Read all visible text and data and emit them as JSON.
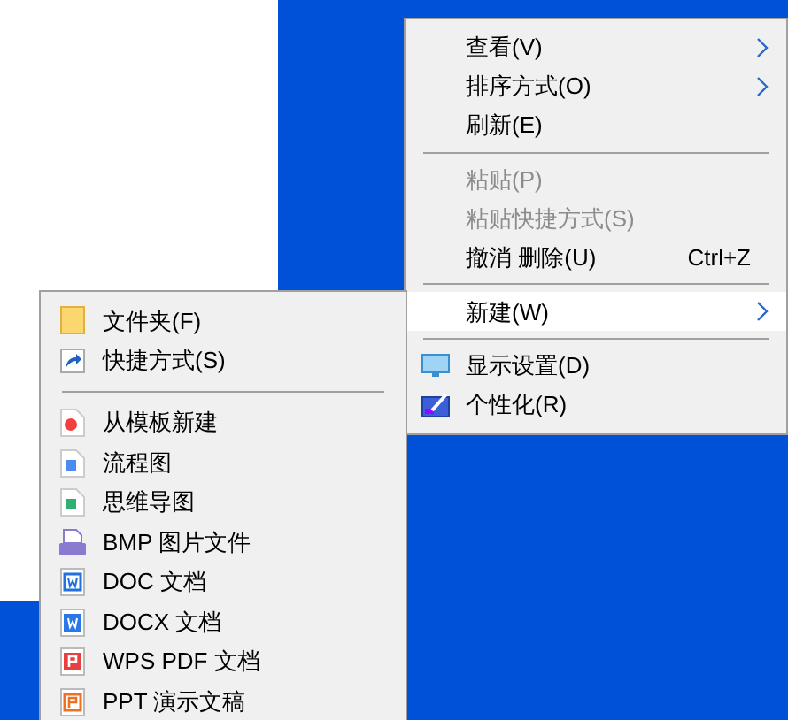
{
  "context_menu": {
    "items": [
      {
        "kind": "submenu",
        "label": "查看(V)",
        "disabled": false,
        "selected": false
      },
      {
        "kind": "submenu",
        "label": "排序方式(O)",
        "disabled": false,
        "selected": false
      },
      {
        "kind": "command",
        "label": "刷新(E)",
        "disabled": false,
        "selected": false
      },
      {
        "kind": "separator"
      },
      {
        "kind": "command",
        "label": "粘贴(P)",
        "disabled": true,
        "selected": false
      },
      {
        "kind": "command",
        "label": "粘贴快捷方式(S)",
        "disabled": true,
        "selected": false
      },
      {
        "kind": "command",
        "label": "撤消 删除(U)",
        "shortcut": "Ctrl+Z",
        "disabled": false,
        "selected": false
      },
      {
        "kind": "separator"
      },
      {
        "kind": "submenu",
        "label": "新建(W)",
        "disabled": false,
        "selected": true
      },
      {
        "kind": "separator"
      },
      {
        "kind": "display",
        "label": "显示设置(D)",
        "disabled": false,
        "selected": false
      },
      {
        "kind": "personalize",
        "label": "个性化(R)",
        "disabled": false,
        "selected": false
      }
    ]
  },
  "new_submenu": {
    "items": [
      {
        "kind": "folder",
        "label": "文件夹(F)"
      },
      {
        "kind": "shortcut",
        "label": "快捷方式(S)"
      },
      {
        "kind": "separator"
      },
      {
        "kind": "template",
        "label": "从模板新建"
      },
      {
        "kind": "flowchart",
        "label": "流程图"
      },
      {
        "kind": "mindmap",
        "label": "思维导图"
      },
      {
        "kind": "bmp",
        "label": "BMP 图片文件"
      },
      {
        "kind": "doc",
        "label": "DOC 文档"
      },
      {
        "kind": "docx",
        "label": "DOCX 文档"
      },
      {
        "kind": "pdf",
        "label": "WPS PDF 文档"
      },
      {
        "kind": "ppt",
        "label": "PPT 演示文稿"
      }
    ]
  }
}
